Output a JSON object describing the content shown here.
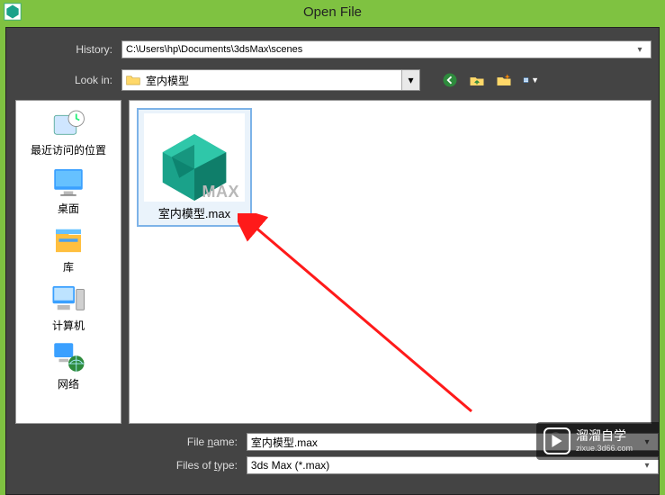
{
  "title": "Open File",
  "history": {
    "label": "History:",
    "value": "C:\\Users\\hp\\Documents\\3dsMax\\scenes"
  },
  "lookin": {
    "label": "Look in:",
    "value": "室内模型"
  },
  "toolbar": {
    "back": "back-icon",
    "up": "up-one-level-icon",
    "newfolder": "create-new-folder-icon",
    "viewmenu": "view-menu-icon"
  },
  "places": [
    {
      "label": "最近访问的位置",
      "icon": "recent-places"
    },
    {
      "label": "桌面",
      "icon": "desktop"
    },
    {
      "label": "库",
      "icon": "libraries"
    },
    {
      "label": "计算机",
      "icon": "computer"
    },
    {
      "label": "网络",
      "icon": "network"
    }
  ],
  "files": [
    {
      "name": "室内模型.max",
      "thumb_tag": "MAX"
    }
  ],
  "filename": {
    "label_pre": "File ",
    "label_u": "n",
    "label_post": "ame:",
    "value": "室内模型.max"
  },
  "filetype": {
    "label_pre": "Files of ",
    "label_u": "t",
    "label_post": "ype:",
    "value": "3ds Max (*.max)"
  },
  "watermark": {
    "main": "溜溜自学",
    "sub": "zixue.3d66.com"
  }
}
